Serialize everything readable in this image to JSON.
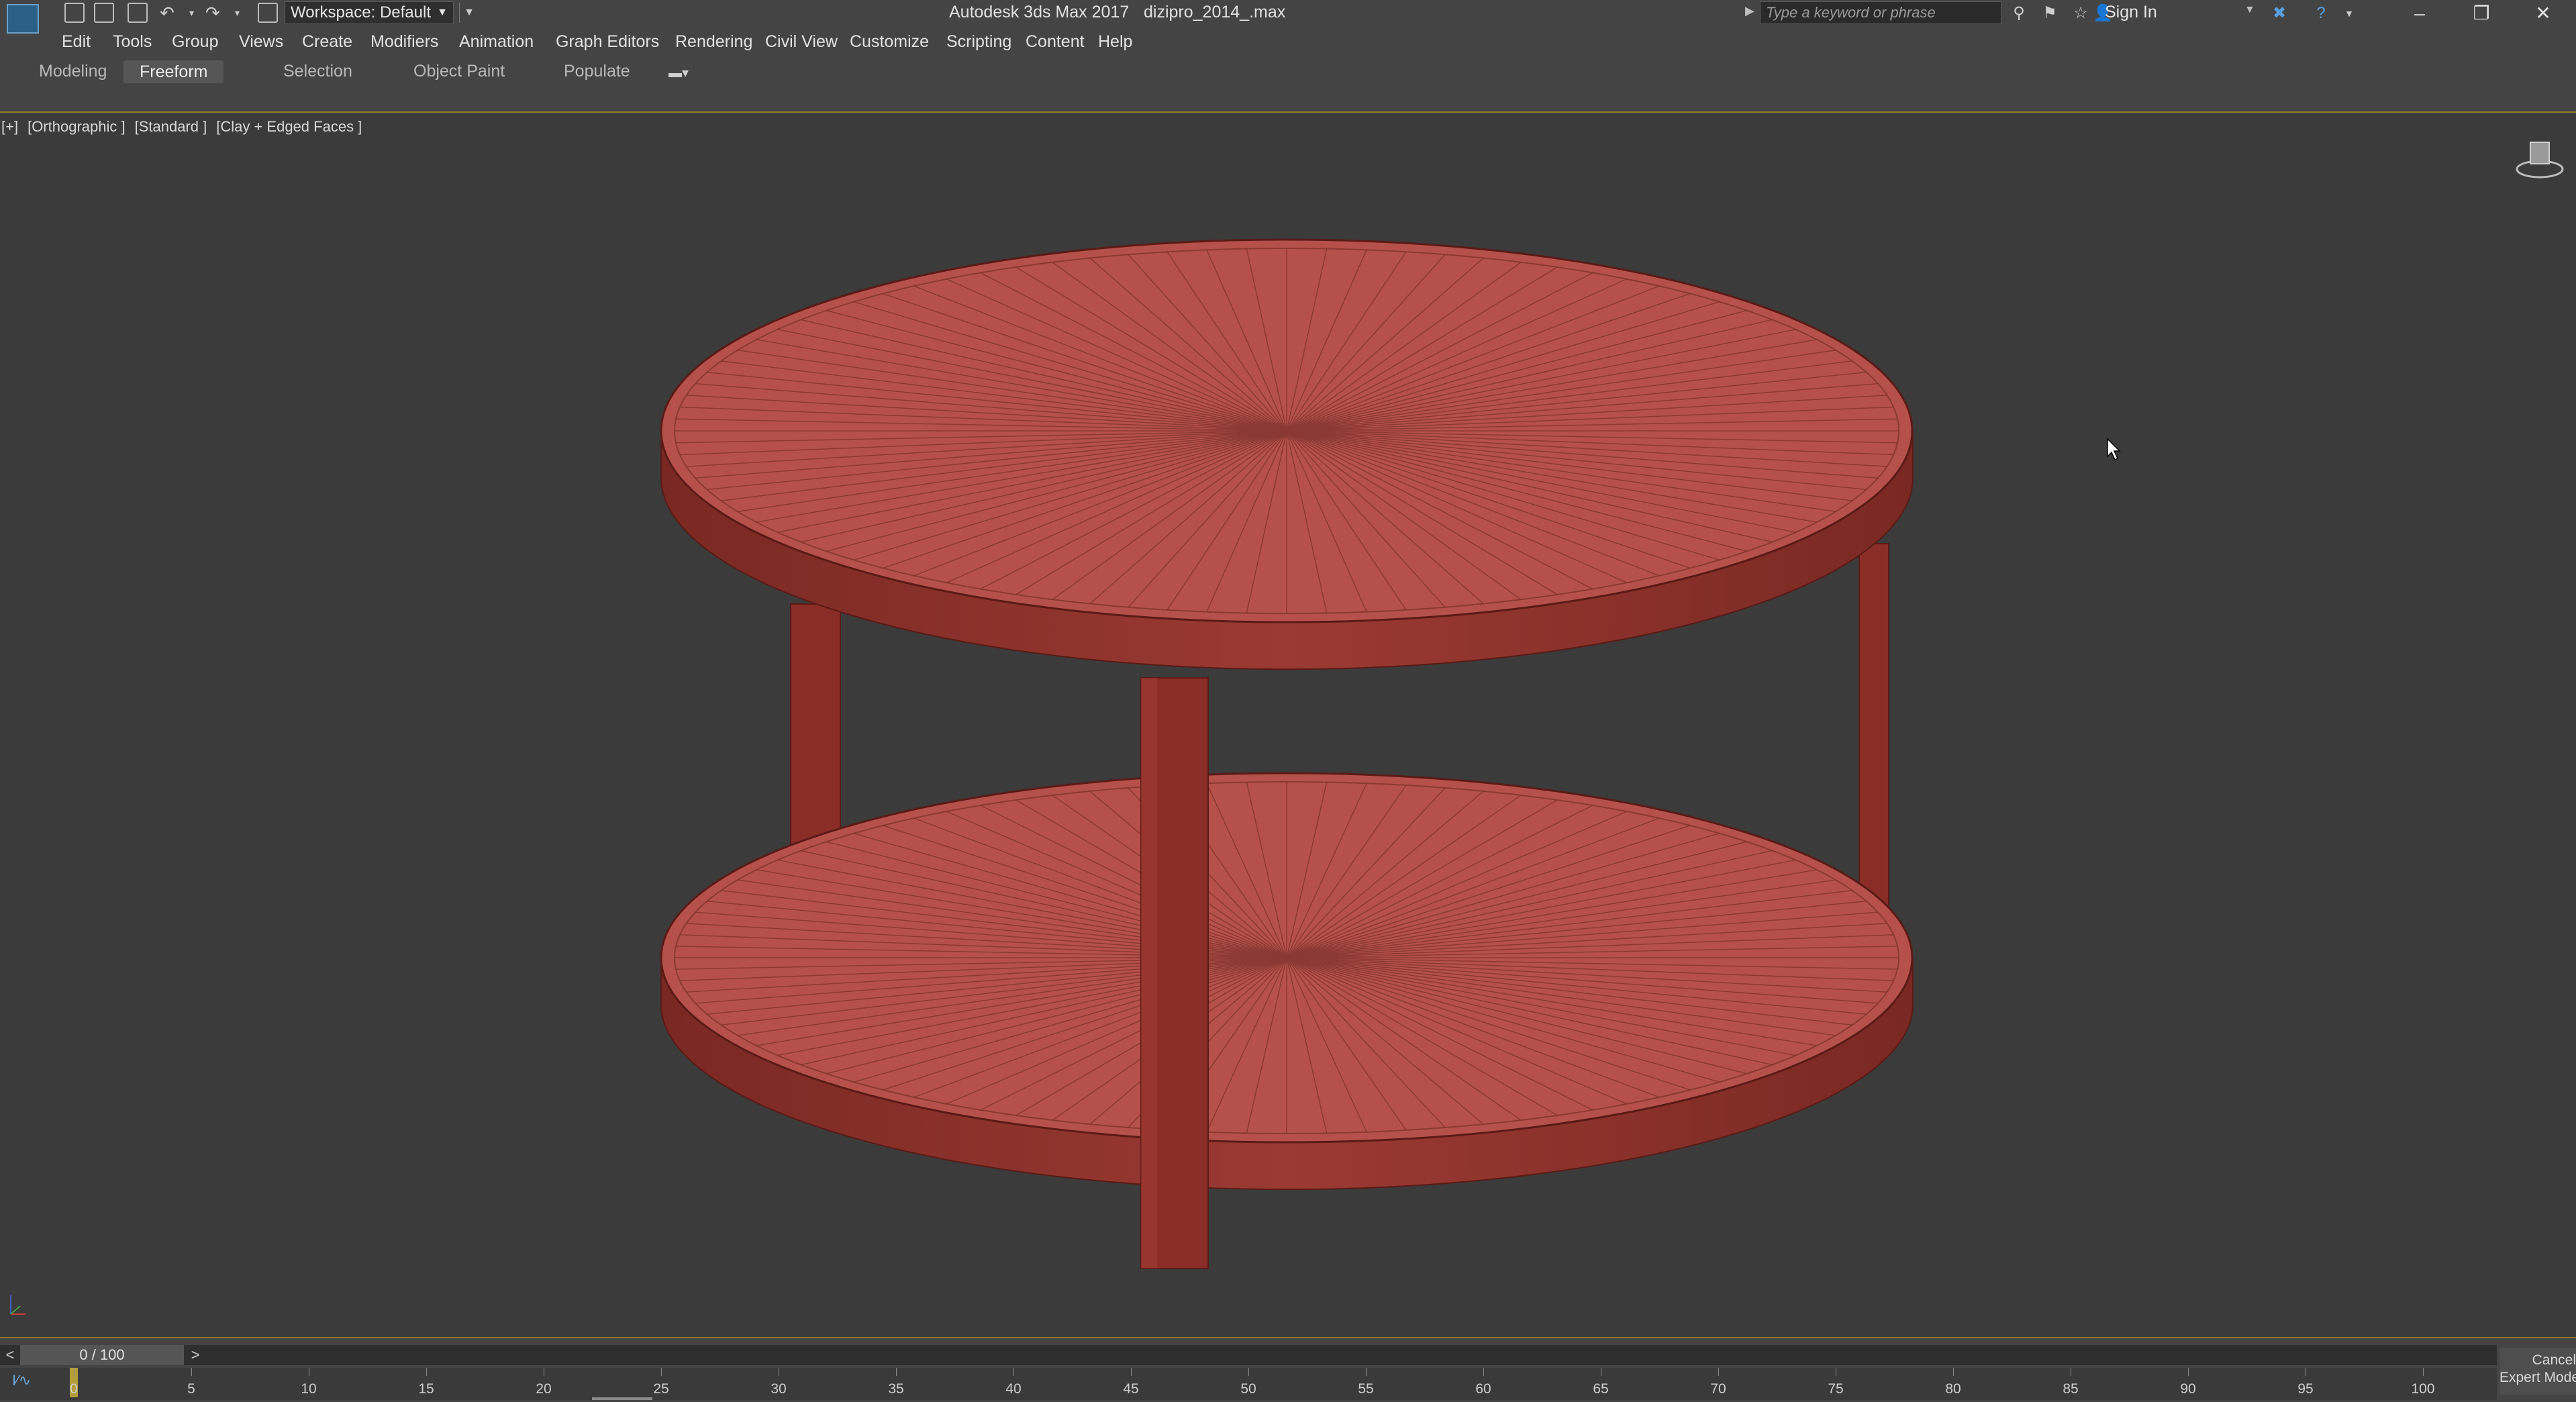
{
  "window": {
    "app_title": "Autodesk 3ds Max 2017",
    "file_title": "dizipro_2014_.max",
    "workspace_label": "Workspace: Default",
    "search_placeholder": "Type a keyword or phrase",
    "sign_in": "Sign In"
  },
  "menu": [
    "Edit",
    "Tools",
    "Group",
    "Views",
    "Create",
    "Modifiers",
    "Animation",
    "Graph Editors",
    "Rendering",
    "Civil View",
    "Customize",
    "Scripting",
    "Content",
    "Help"
  ],
  "ribbon_tabs": [
    {
      "label": "Modeling",
      "active": false
    },
    {
      "label": "Freeform",
      "active": true
    },
    {
      "label": "Selection",
      "active": false
    },
    {
      "label": "Object Paint",
      "active": false
    },
    {
      "label": "Populate",
      "active": false
    }
  ],
  "viewport": {
    "labels": [
      "[+]",
      "[Orthographic ]",
      "[Standard ]",
      "[Clay + Edged Faces ]"
    ]
  },
  "timeline": {
    "slider_label": "0 / 100",
    "prev": "<",
    "next": ">",
    "ticks": [
      "0",
      "5",
      "10",
      "15",
      "20",
      "25",
      "30",
      "35",
      "40",
      "45",
      "50",
      "55",
      "60",
      "65",
      "70",
      "75",
      "80",
      "85",
      "90",
      "95",
      "100"
    ],
    "cancel_label": "Cancel",
    "expert_label": "Expert Mode"
  },
  "colors": {
    "model_top": "#b5514a",
    "model_side": "#8a2d27",
    "accent": "#8f7a2a",
    "viewport_bg": "#3b3b3b"
  },
  "icons": [
    "app-logo-icon",
    "new-file-icon",
    "open-file-icon",
    "save-icon",
    "undo-icon",
    "redo-icon",
    "project-icon",
    "search-arrow-icon",
    "binoculars-icon",
    "favorites-icon",
    "star-icon",
    "user-icon",
    "exchange-icon",
    "help-icon",
    "minimize-icon",
    "restore-icon",
    "close-icon",
    "viewcube-icon",
    "cursor-icon"
  ]
}
